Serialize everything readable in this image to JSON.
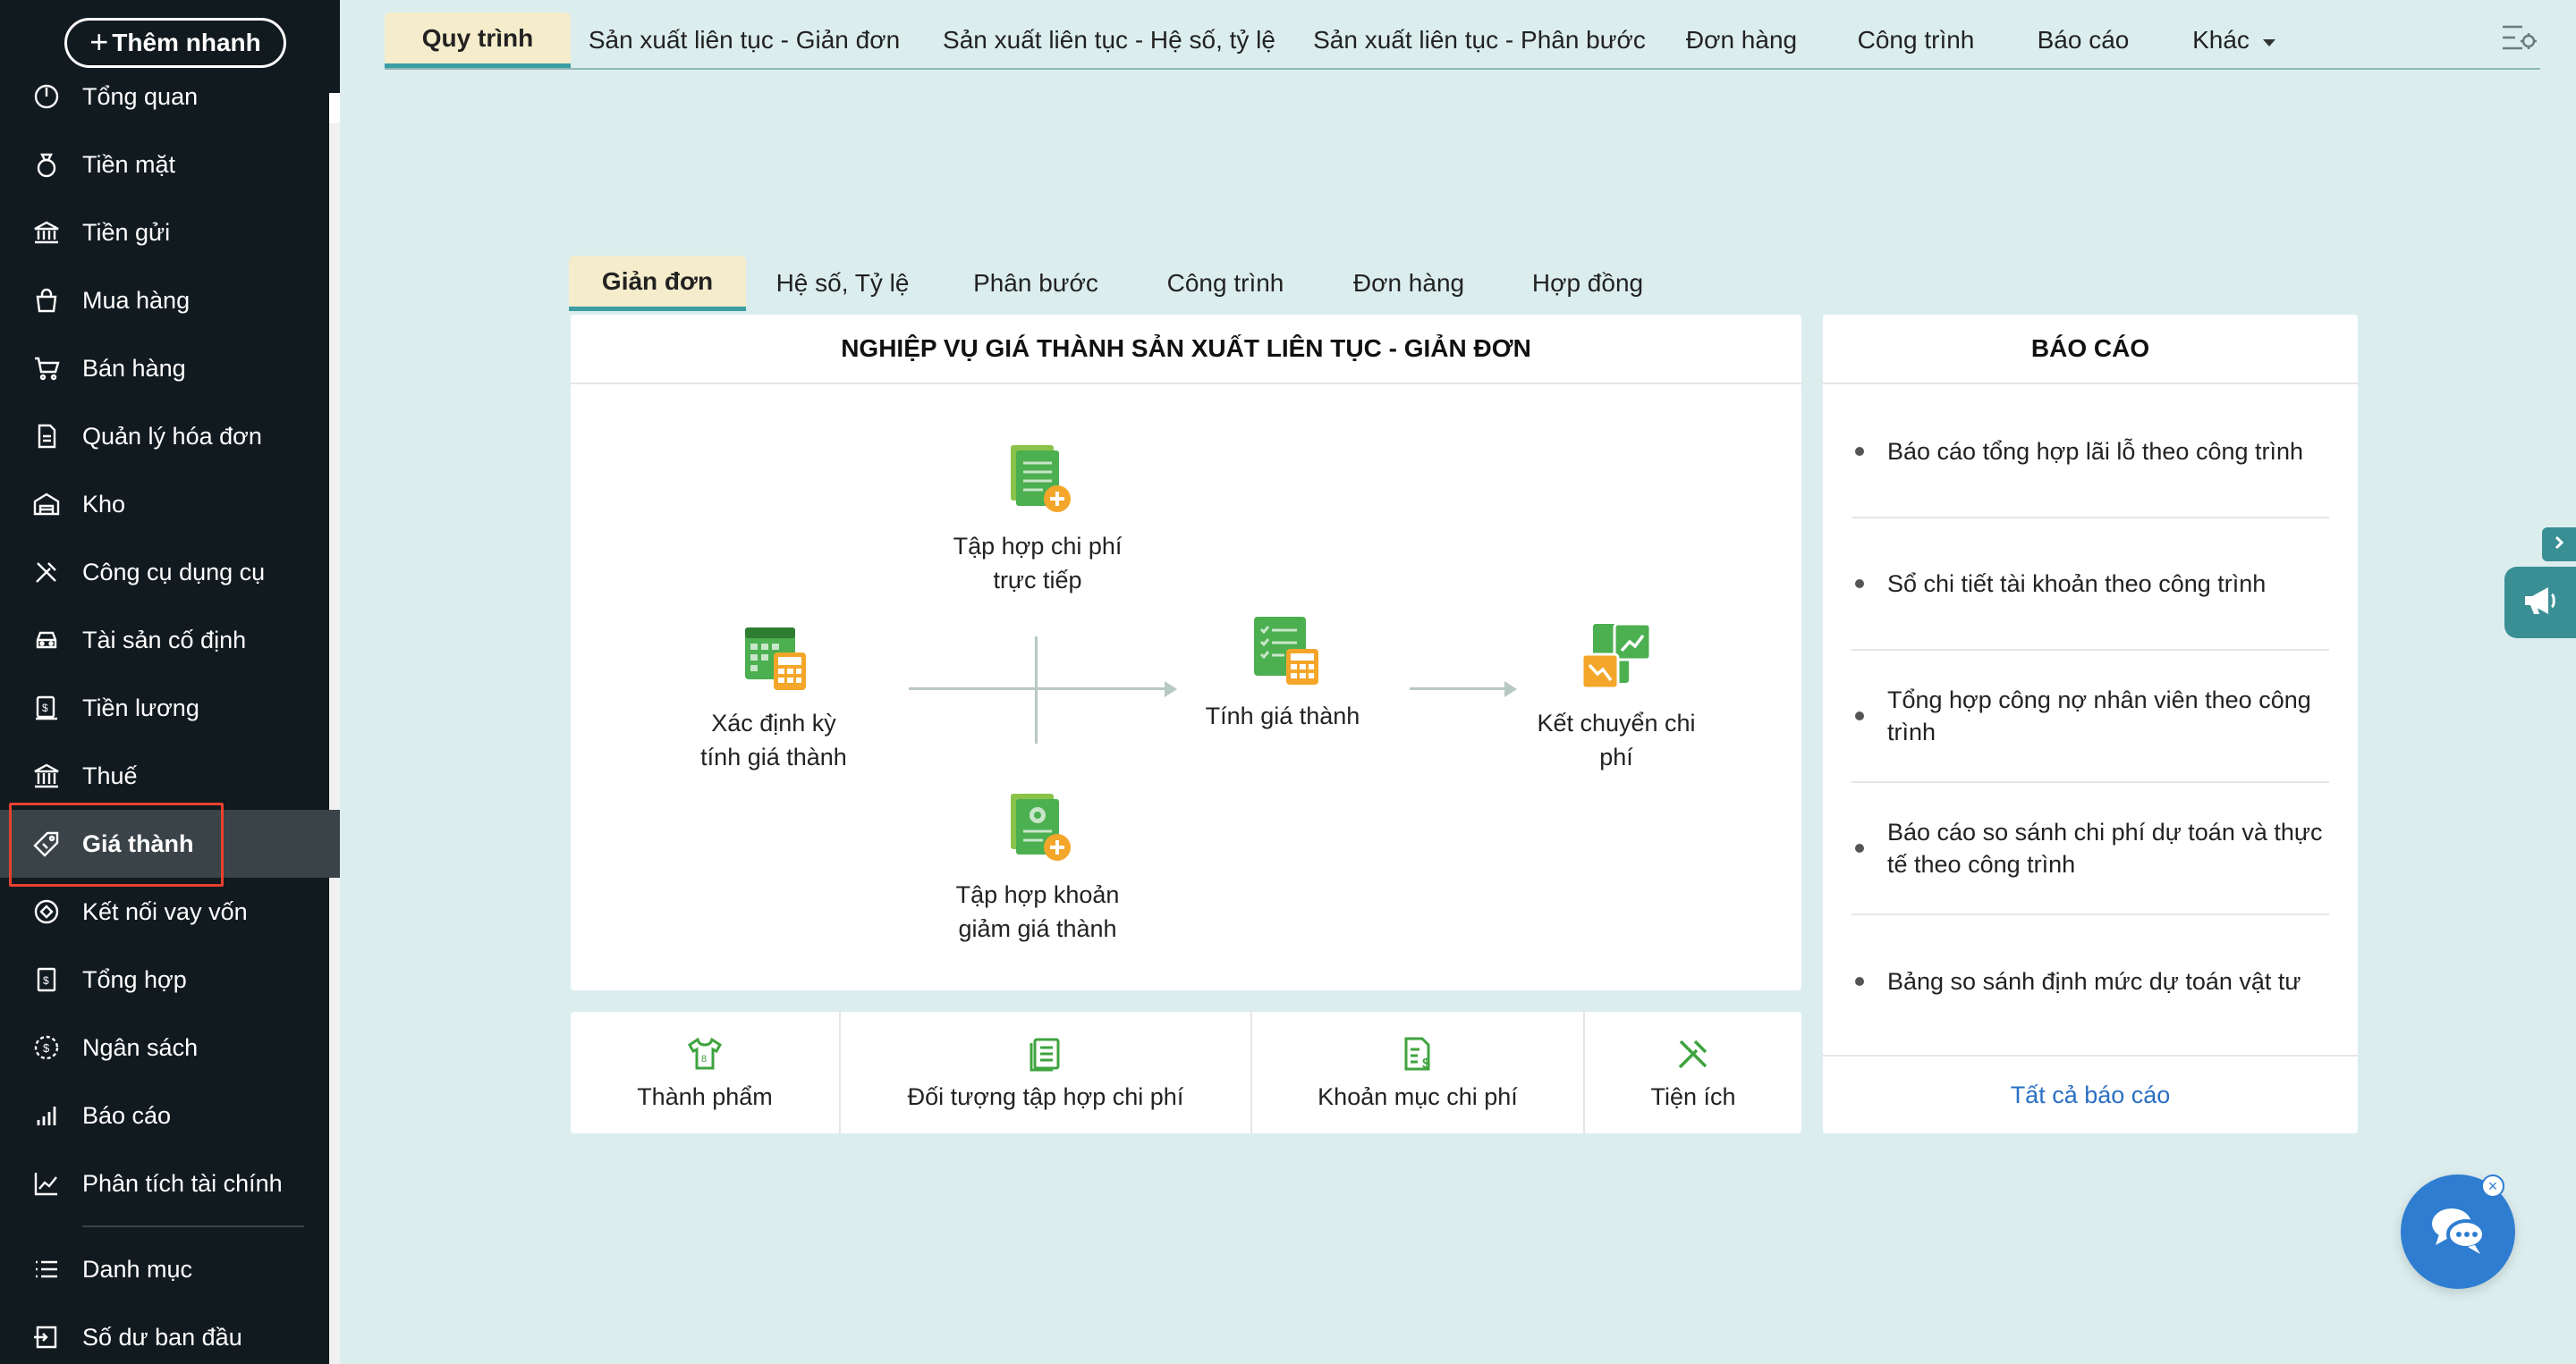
{
  "sidebar": {
    "quick_add_label": "Thêm nhanh",
    "items": [
      {
        "label": "Tổng quan",
        "icon": "gauge-icon"
      },
      {
        "label": "Tiền mặt",
        "icon": "money-bag-icon"
      },
      {
        "label": "Tiền gửi",
        "icon": "bank-icon"
      },
      {
        "label": "Mua hàng",
        "icon": "shopping-bag-icon"
      },
      {
        "label": "Bán hàng",
        "icon": "cart-icon"
      },
      {
        "label": "Quản lý hóa đơn",
        "icon": "invoice-icon"
      },
      {
        "label": "Kho",
        "icon": "warehouse-icon"
      },
      {
        "label": "Công cụ dụng cụ",
        "icon": "tools-icon"
      },
      {
        "label": "Tài sản cố định",
        "icon": "car-icon"
      },
      {
        "label": "Tiền lương",
        "icon": "payroll-icon"
      },
      {
        "label": "Thuế",
        "icon": "tax-building-icon"
      },
      {
        "label": "Giá thành",
        "icon": "price-tag-icon",
        "active": true
      },
      {
        "label": "Kết nối vay vốn",
        "icon": "loan-link-icon"
      },
      {
        "label": "Tổng hợp",
        "icon": "ledger-icon"
      },
      {
        "label": "Ngân sách",
        "icon": "budget-icon"
      },
      {
        "label": "Báo cáo",
        "icon": "bar-chart-icon"
      },
      {
        "label": "Phân tích tài chính",
        "icon": "trend-chart-icon"
      },
      {
        "label": "Danh mục",
        "icon": "list-icon"
      },
      {
        "label": "Số dư ban đầu",
        "icon": "opening-balance-icon"
      }
    ]
  },
  "top_tabs": [
    {
      "label": "Quy trình",
      "active": true
    },
    {
      "label": "Sản xuất liên tục - Giản đơn"
    },
    {
      "label": "Sản xuất liên tục - Hệ số, tỷ lệ"
    },
    {
      "label": "Sản xuất liên tục - Phân bước"
    },
    {
      "label": "Đơn hàng"
    },
    {
      "label": "Công trình"
    },
    {
      "label": "Báo cáo"
    },
    {
      "label": "Khác"
    }
  ],
  "inner_tabs": [
    {
      "label": "Giản đơn",
      "active": true
    },
    {
      "label": "Hệ số, Tỷ lệ"
    },
    {
      "label": "Phân bước"
    },
    {
      "label": "Công trình"
    },
    {
      "label": "Đơn hàng"
    },
    {
      "label": "Hợp đồng"
    }
  ],
  "process": {
    "title": "NGHIỆP VỤ GIÁ THÀNH SẢN XUẤT LIÊN TỤC - GIẢN ĐƠN",
    "nodes": {
      "period": {
        "line1": "Xác định kỳ",
        "line2": "tính giá thành"
      },
      "direct_cost": {
        "line1": "Tập hợp chi phí",
        "line2": "trực tiếp"
      },
      "reduction": {
        "line1": "Tập hợp khoản",
        "line2": "giảm giá thành"
      },
      "calc": {
        "line1": "Tính giá thành"
      },
      "transfer": {
        "line1": "Kết chuyển chi",
        "line2": "phí"
      }
    }
  },
  "utilities": [
    {
      "label": "Thành phẩm",
      "icon": "shirt-icon"
    },
    {
      "label": "Đối tượng tập hợp chi phí",
      "icon": "document-icon"
    },
    {
      "label": "Khoản mục chi phí",
      "icon": "cost-item-icon"
    },
    {
      "label": "Tiện ích",
      "icon": "tools-icon"
    }
  ],
  "reports": {
    "title": "BÁO CÁO",
    "items": [
      "Báo cáo tổng hợp lãi lỗ theo công trình",
      "Sổ chi tiết tài khoản theo công trình",
      "Tổng hợp công nợ nhân viên theo công trình",
      "Báo cáo so sánh chi phí dự toán và thực tế theo công trình",
      "Bảng so sánh định mức dự toán vật tư"
    ],
    "all_label": "Tất cả báo cáo"
  },
  "colors": {
    "sidebar_bg": "#111a1f",
    "active_tab_bg": "#f4eccb",
    "accent_teal": "#3a9ea3",
    "link_blue": "#2a6fc4",
    "highlight_red": "#e8412f",
    "icon_green": "#4caf50",
    "icon_orange": "#f4a62a"
  }
}
